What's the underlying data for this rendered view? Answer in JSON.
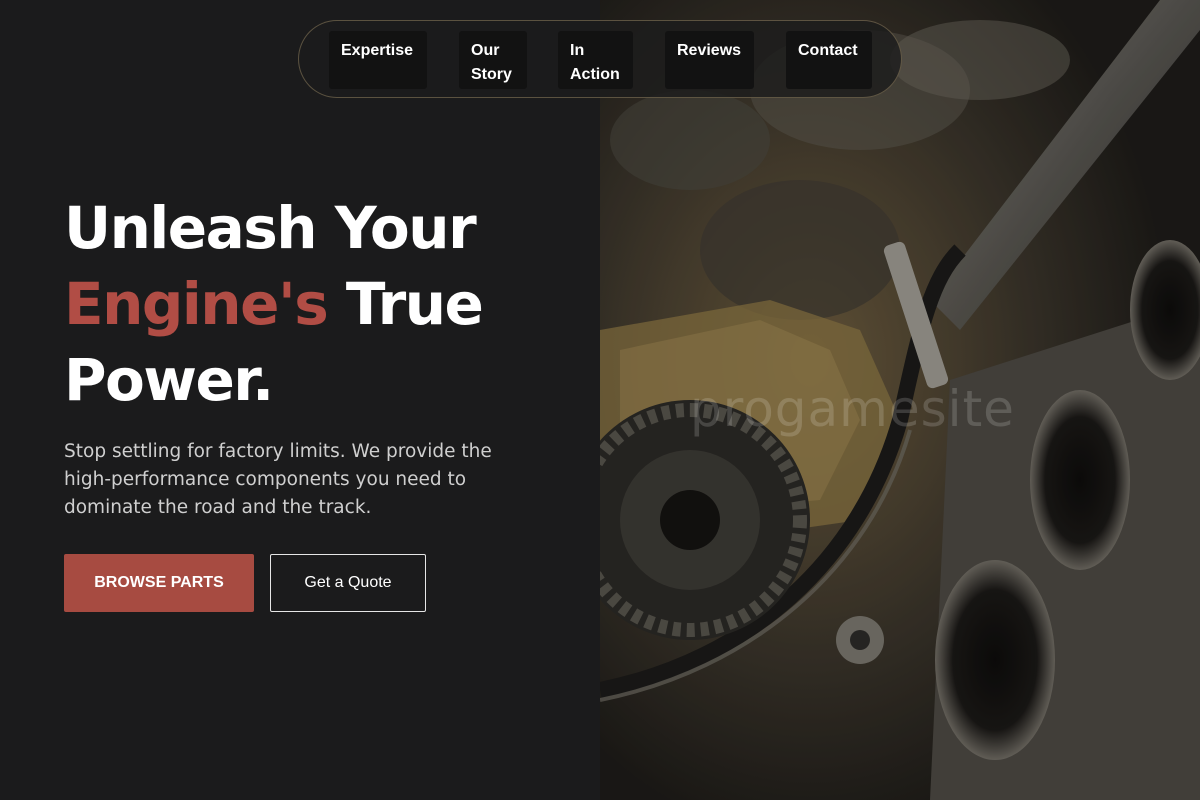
{
  "nav": {
    "items": [
      {
        "label": "Expertise"
      },
      {
        "label": "Our Story"
      },
      {
        "label": "In Action"
      },
      {
        "label": "Reviews"
      },
      {
        "label": "Contact"
      }
    ]
  },
  "hero": {
    "title_line1": "Unleash Your",
    "title_accent": "Engine's",
    "title_line2_rest": " True",
    "title_line3": "Power.",
    "subtitle": "Stop settling for factory limits. We provide the high-performance components you need to dominate the road and the track.",
    "primary_button": "BROWSE PARTS",
    "secondary_button": "Get a Quote"
  },
  "image": {
    "icon": "engine-photo",
    "watermark": "progamesite"
  },
  "colors": {
    "background": "#1b1b1c",
    "accent": "#b14d45",
    "primary_button": "#a74b41",
    "text": "#ffffff",
    "subtitle": "#cfcfcf"
  }
}
